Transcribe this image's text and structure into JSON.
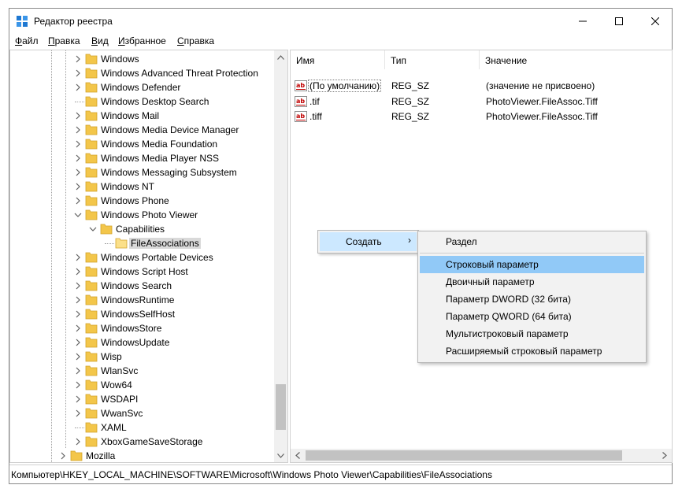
{
  "window": {
    "title": "Редактор реестра",
    "minimize_glyph": "—",
    "maximize_glyph": "☐",
    "close_glyph": "✕"
  },
  "menu": [
    {
      "pre": "",
      "u": "Ф",
      "post": "айл"
    },
    {
      "pre": "",
      "u": "П",
      "post": "равка"
    },
    {
      "pre": "",
      "u": "В",
      "post": "ид"
    },
    {
      "pre": "",
      "u": "И",
      "post": "збранное"
    },
    {
      "pre": "",
      "u": "С",
      "post": "правка"
    }
  ],
  "tree": [
    {
      "label": "Windows",
      "arrow": "right"
    },
    {
      "label": "Windows Advanced Threat Protection",
      "arrow": "right"
    },
    {
      "label": "Windows Defender",
      "arrow": "right"
    },
    {
      "label": "Windows Desktop Search",
      "arrow": "none"
    },
    {
      "label": "Windows Mail",
      "arrow": "right"
    },
    {
      "label": "Windows Media Device Manager",
      "arrow": "right"
    },
    {
      "label": "Windows Media Foundation",
      "arrow": "right"
    },
    {
      "label": "Windows Media Player NSS",
      "arrow": "right"
    },
    {
      "label": "Windows Messaging Subsystem",
      "arrow": "right"
    },
    {
      "label": "Windows NT",
      "arrow": "right"
    },
    {
      "label": "Windows Phone",
      "arrow": "right"
    },
    {
      "label": "Windows Photo Viewer",
      "arrow": "down"
    },
    {
      "label": "Capabilities",
      "arrow": "down"
    },
    {
      "label": "FileAssociations",
      "arrow": "none",
      "selected": true
    },
    {
      "label": "Windows Portable Devices",
      "arrow": "right"
    },
    {
      "label": "Windows Script Host",
      "arrow": "right"
    },
    {
      "label": "Windows Search",
      "arrow": "right"
    },
    {
      "label": "WindowsRuntime",
      "arrow": "right"
    },
    {
      "label": "WindowsSelfHost",
      "arrow": "right"
    },
    {
      "label": "WindowsStore",
      "arrow": "right"
    },
    {
      "label": "WindowsUpdate",
      "arrow": "right"
    },
    {
      "label": "Wisp",
      "arrow": "right"
    },
    {
      "label": "WlanSvc",
      "arrow": "right"
    },
    {
      "label": "Wow64",
      "arrow": "right"
    },
    {
      "label": "WSDAPI",
      "arrow": "right"
    },
    {
      "label": "WwanSvc",
      "arrow": "right"
    },
    {
      "label": "XAML",
      "arrow": "none"
    },
    {
      "label": "XboxGameSaveStorage",
      "arrow": "right"
    },
    {
      "label": "Mozilla",
      "arrow": "right"
    }
  ],
  "list": {
    "columns": [
      "Имя",
      "Тип",
      "Значение"
    ],
    "rows": [
      {
        "name": "(По умолчанию)",
        "type": "REG_SZ",
        "value": "(значение не присвоено)"
      },
      {
        "name": ".tif",
        "type": "REG_SZ",
        "value": "PhotoViewer.FileAssoc.Tiff"
      },
      {
        "name": ".tiff",
        "type": "REG_SZ",
        "value": "PhotoViewer.FileAssoc.Tiff"
      }
    ]
  },
  "context_menu": {
    "create_label": "Создать",
    "submenu": [
      "Раздел",
      "Строковый параметр",
      "Двоичный параметр",
      "Параметр DWORD (32 бита)",
      "Параметр QWORD (64 бита)",
      "Мультистроковый параметр",
      "Расширяемый строковый параметр"
    ],
    "highlighted_index": 1
  },
  "status": "Компьютер\\HKEY_LOCAL_MACHINE\\SOFTWARE\\Microsoft\\Windows Photo Viewer\\Capabilities\\FileAssociations",
  "colors": {
    "menu_highlight": "#91c9f7",
    "create_highlight": "#cce8ff",
    "folder": "#f3c64a"
  }
}
